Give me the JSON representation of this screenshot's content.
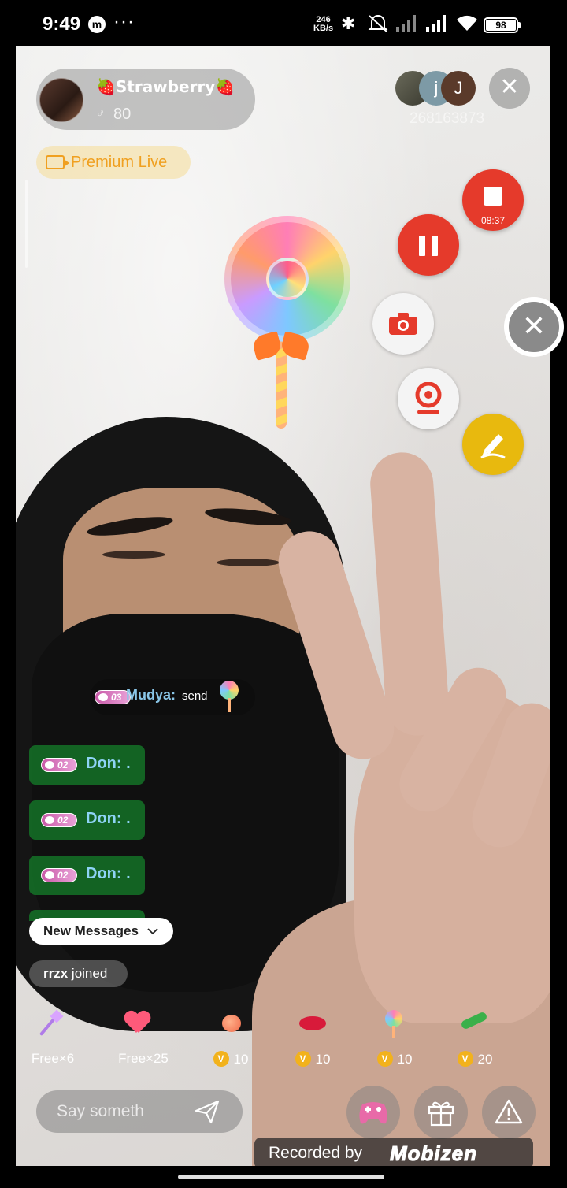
{
  "status_bar": {
    "time": "9:49",
    "app_icon": "m",
    "more": "···",
    "net_speed_value": "246",
    "net_speed_unit": "KB/s",
    "battery": "98",
    "icons": [
      "bluetooth-icon",
      "silent-icon",
      "signal-icon",
      "signal-icon",
      "wifi-icon",
      "battery-icon"
    ]
  },
  "host": {
    "name": "🍓Strawberry🍓",
    "viewer_icon": "♂",
    "viewers": "80"
  },
  "premium": {
    "label": "Premium Live"
  },
  "viewers_avatars": [
    {
      "initial": ""
    },
    {
      "initial": "j"
    },
    {
      "initial": "J"
    }
  ],
  "room_id": "268163873",
  "close_label": "✕",
  "recorder": {
    "elapsed": "08:37",
    "close_label": "✕"
  },
  "gift_notice": {
    "level": "03",
    "user": "Mudya:",
    "action": "send"
  },
  "chat": [
    {
      "level": "02",
      "text": "Don: ."
    },
    {
      "level": "02",
      "text": "Don: ."
    },
    {
      "level": "02",
      "text": "Don: ."
    }
  ],
  "new_messages": {
    "label": "New Messages"
  },
  "joined": {
    "user": "rrzx",
    "text": "joined"
  },
  "gifts": [
    {
      "icon": "wand-icon",
      "price": "Free×6",
      "coin": false
    },
    {
      "icon": "heart-icon",
      "price": "Free×25",
      "coin": false
    },
    {
      "icon": "peach-icon",
      "price": "10",
      "coin": true
    },
    {
      "icon": "lips-icon",
      "price": "10",
      "coin": true
    },
    {
      "icon": "lollipop-icon",
      "price": "10",
      "coin": true
    },
    {
      "icon": "cucumber-icon",
      "price": "20",
      "coin": true
    }
  ],
  "coin_symbol": "V",
  "input": {
    "placeholder": "Say someth"
  },
  "watermark": {
    "text": "Recorded by",
    "logo": "Mobizen"
  },
  "colors": {
    "recorder_red": "#e53a2b",
    "draw_yellow": "#e8b90e",
    "premium_orange": "#f0a020",
    "chat_green": "#14782a",
    "chat_name_blue": "#8ed3f5",
    "coin_gold": "#f2b21c"
  }
}
